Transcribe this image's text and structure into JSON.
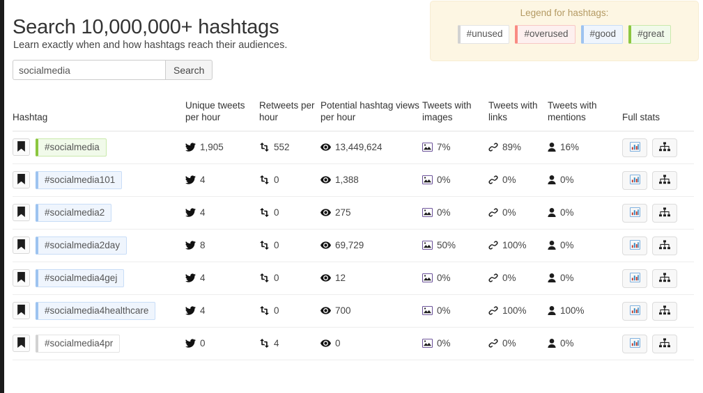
{
  "header": {
    "title": "Search 10,000,000+ hashtags",
    "subtitle": "Learn exactly when and how hashtags reach their audiences.",
    "search": {
      "value": "socialmedia",
      "placeholder": "",
      "button_label": "Search"
    }
  },
  "legend": {
    "title": "Legend for hashtags:",
    "items": [
      {
        "label": "#unused",
        "kind": "unused",
        "border_color": "#d2d2d2",
        "bg_color": "#ffffff"
      },
      {
        "label": "#overused",
        "kind": "overused",
        "border_color": "#f98b82",
        "bg_color": "#fdf0ef"
      },
      {
        "label": "#good",
        "kind": "good",
        "border_color": "#9dc3f0",
        "bg_color": "#eff5fd"
      },
      {
        "label": "#great",
        "kind": "great",
        "border_color": "#8cc63f",
        "bg_color": "#f1faea"
      }
    ]
  },
  "table": {
    "columns": [
      "Hashtag",
      "Unique tweets per hour",
      "Retweets per hour",
      "Potential hashtag views per hour",
      "Tweets with images",
      "Tweets with links",
      "Tweets with mentions",
      "Full stats"
    ],
    "icons": {
      "bookmark": "bookmark-icon",
      "unique": "twitter-bird-icon",
      "retweets": "retweet-icon",
      "views": "eye-icon",
      "images": "image-icon",
      "links": "link-icon",
      "mentions": "user-icon",
      "chart": "bar-chart-icon",
      "sitemap": "sitemap-icon"
    },
    "rows": [
      {
        "hashtag": "#socialmedia",
        "kind": "great",
        "unique": "1,905",
        "retweets": "552",
        "views": "13,449,624",
        "images": "7%",
        "links": "89%",
        "mentions": "16%"
      },
      {
        "hashtag": "#socialmedia101",
        "kind": "good",
        "unique": "4",
        "retweets": "0",
        "views": "1,388",
        "images": "0%",
        "links": "0%",
        "mentions": "0%"
      },
      {
        "hashtag": "#socialmedia2",
        "kind": "good",
        "unique": "4",
        "retweets": "0",
        "views": "275",
        "images": "0%",
        "links": "0%",
        "mentions": "0%"
      },
      {
        "hashtag": "#socialmedia2day",
        "kind": "good",
        "unique": "8",
        "retweets": "0",
        "views": "69,729",
        "images": "50%",
        "links": "100%",
        "mentions": "0%"
      },
      {
        "hashtag": "#socialmedia4gej",
        "kind": "good",
        "unique": "4",
        "retweets": "0",
        "views": "12",
        "images": "0%",
        "links": "0%",
        "mentions": "0%"
      },
      {
        "hashtag": "#socialmedia4healthcare",
        "kind": "good",
        "unique": "4",
        "retweets": "0",
        "views": "700",
        "images": "0%",
        "links": "100%",
        "mentions": "100%"
      },
      {
        "hashtag": "#socialmedia4pr",
        "kind": "unused",
        "unique": "0",
        "retweets": "4",
        "views": "0",
        "images": "0%",
        "links": "0%",
        "mentions": "0%"
      }
    ]
  }
}
